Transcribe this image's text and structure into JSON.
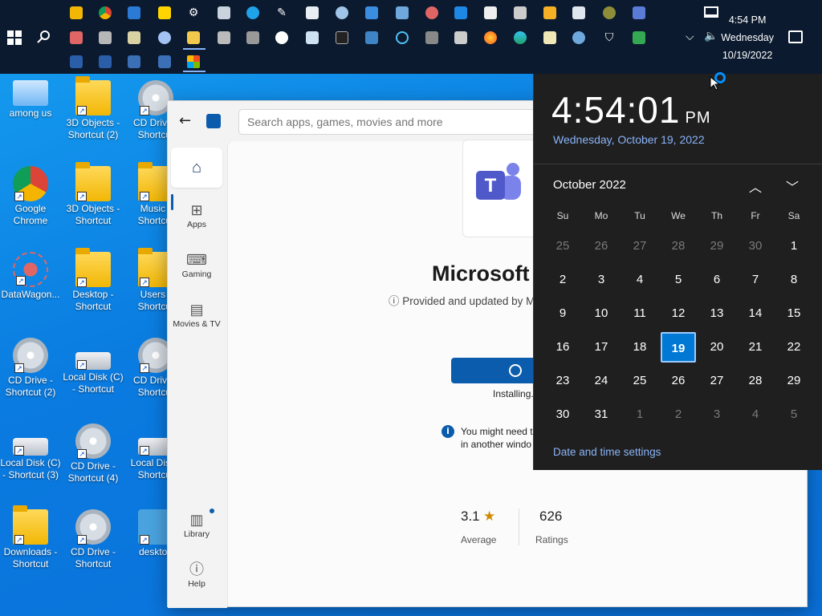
{
  "taskbar": {
    "time": "4:54 PM",
    "day": "Wednesday",
    "date": "10/19/2022"
  },
  "desktop": {
    "icons": [
      {
        "label": "among us",
        "kind": "computer"
      },
      {
        "label": "3D Objects - Shortcut (2)",
        "kind": "folder"
      },
      {
        "label": "CD Drive - Shortcut",
        "kind": "disc"
      },
      {
        "label": "Google Chrome",
        "kind": "chrome"
      },
      {
        "label": "3D Objects - Shortcut",
        "kind": "folder"
      },
      {
        "label": "Music - Shortcut",
        "kind": "folder"
      },
      {
        "label": "DataWagon...",
        "kind": "flower"
      },
      {
        "label": "Desktop - Shortcut",
        "kind": "folder"
      },
      {
        "label": "Users - Shortcut",
        "kind": "folder"
      },
      {
        "label": "CD Drive - Shortcut (2)",
        "kind": "disc"
      },
      {
        "label": "Local Disk (C) - Shortcut",
        "kind": "drive"
      },
      {
        "label": "CD Drive - Shortcut",
        "kind": "disc"
      },
      {
        "label": "Local Disk (C) - Shortcut (3)",
        "kind": "drive"
      },
      {
        "label": "CD Drive - Shortcut (4)",
        "kind": "disc"
      },
      {
        "label": "Local Disk - Shortcut",
        "kind": "drive"
      },
      {
        "label": "Downloads - Shortcut",
        "kind": "folder"
      },
      {
        "label": "CD Drive - Shortcut",
        "kind": "disc"
      },
      {
        "label": "desktop",
        "kind": "gear"
      }
    ]
  },
  "store": {
    "search_placeholder": "Search apps, games, movies and more",
    "nav": {
      "apps": "Apps",
      "gaming": "Gaming",
      "movies": "Movies & TV",
      "library": "Library",
      "help": "Help"
    },
    "app_title": "Microsoft",
    "provided_by": "ⓘ Provided and updated by M",
    "installing": "Installing...",
    "info_line1": "You might need t",
    "info_line2": "in another windo",
    "rating": "3.1",
    "rating_label": "Average",
    "ratings_count": "626",
    "ratings_label": "Ratings"
  },
  "calendar": {
    "time": "4:54:01",
    "ampm": "PM",
    "full_date": "Wednesday, October 19, 2022",
    "month": "October 2022",
    "weekdays": [
      "Su",
      "Mo",
      "Tu",
      "We",
      "Th",
      "Fr",
      "Sa"
    ],
    "days": [
      [
        "25",
        "26",
        "27",
        "28",
        "29",
        "30",
        "1"
      ],
      [
        "2",
        "3",
        "4",
        "5",
        "6",
        "7",
        "8"
      ],
      [
        "9",
        "10",
        "11",
        "12",
        "13",
        "14",
        "15"
      ],
      [
        "16",
        "17",
        "18",
        "19",
        "20",
        "21",
        "22"
      ],
      [
        "23",
        "24",
        "25",
        "26",
        "27",
        "28",
        "29"
      ],
      [
        "30",
        "31",
        "1",
        "2",
        "3",
        "4",
        "5"
      ]
    ],
    "selected": "19",
    "settings_link": "Date and time settings"
  },
  "colors": {
    "accent": "#0078d4",
    "desktop": "#0a7be0",
    "taskbar": "#0b1a2e"
  }
}
